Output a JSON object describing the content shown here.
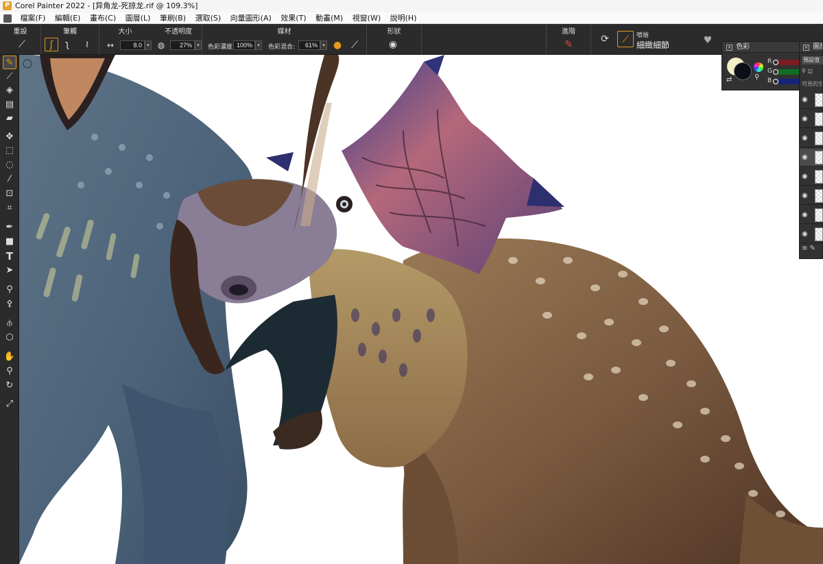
{
  "window": {
    "title": "Corel Painter 2022 - [异角龙-死掠龙.rif @ 109.3%]"
  },
  "menu": [
    "檔案(F)",
    "編輯(E)",
    "畫布(C)",
    "圖層(L)",
    "筆刷(B)",
    "選取(S)",
    "向量圖形(A)",
    "效果(T)",
    "動畫(M)",
    "視窗(W)",
    "說明(H)"
  ],
  "propbar": {
    "reset_label": "重設",
    "stroke_label": "筆觸",
    "size_label": "大小",
    "size_value": "8.0",
    "opacity_label": "不透明度",
    "opacity_value": "27%",
    "media_label": "媒材",
    "color_conc_label": "色彩濃度:",
    "color_conc_value": "100%",
    "color_mix_label": "色彩混合:",
    "color_mix_value": "61%",
    "shape_label": "形狀",
    "advanced_label": "進階",
    "brush_category": "噴槍",
    "brush_variant": "細緻細節"
  },
  "color_panel": {
    "title": "色彩",
    "r_label": "R",
    "g_label": "G",
    "b_label": "B",
    "preset_label": "預設值",
    "hint_text": "可見的空",
    "main_color": "#0b1016",
    "secondary_color": "#f3efc7"
  },
  "layers_panel": {
    "title": "圖層",
    "rows": 8,
    "selected_row": 3
  },
  "tools": [
    "brush-tool",
    "dropper-tool",
    "paint-bucket-tool",
    "gradient-tool",
    "eraser-tool",
    "layer-adjuster-tool",
    "rect-select-tool",
    "lasso-tool",
    "magic-wand-tool",
    "transform-tool",
    "crop-tool",
    "pen-tool",
    "rectangle-shape-tool",
    "text-tool",
    "shape-select-tool",
    "cloner-tool",
    "rubber-stamp-tool",
    "mirror-tool",
    "perspective-guide-tool",
    "grabber-tool",
    "magnifier-tool",
    "rotate-page-tool",
    "fit-screen-tool"
  ]
}
